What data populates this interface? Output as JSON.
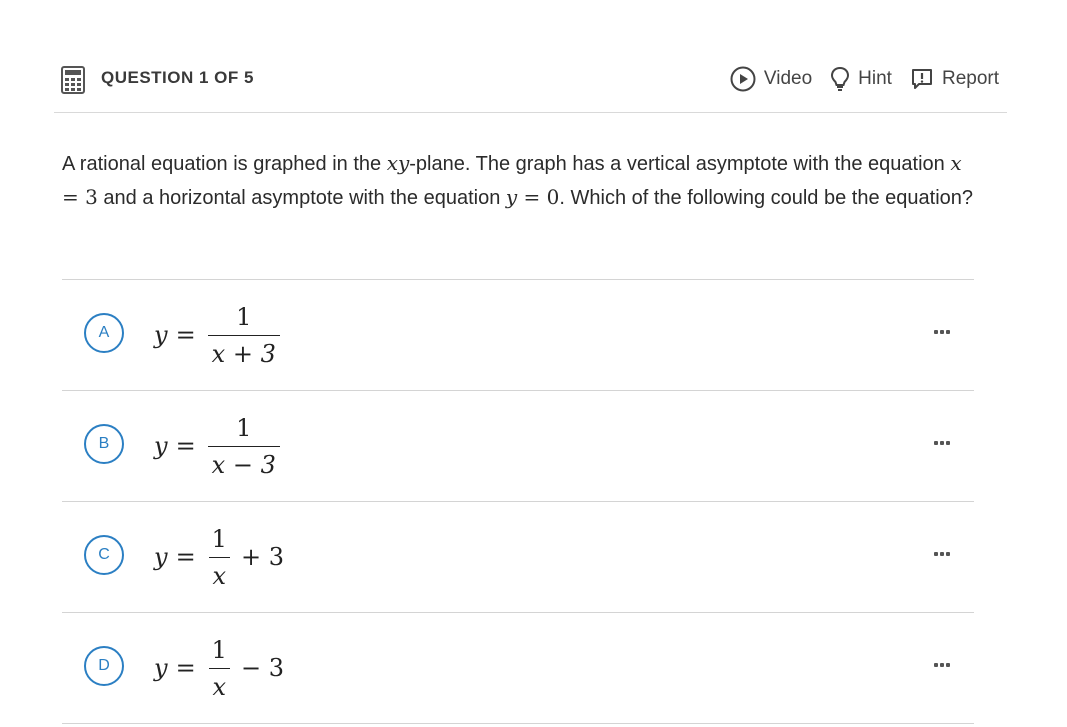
{
  "header": {
    "question_label": "QUESTION 1 OF 5",
    "actions": {
      "video": "Video",
      "hint": "Hint",
      "report": "Report"
    }
  },
  "question": {
    "text_1": "A rational equation is graphed in the ",
    "math_xy": "xy",
    "text_2": "-plane. The graph has a vertical asymptote with the equation ",
    "math_x": "x",
    "math_eq1": " = 3",
    "text_3": " and a horizontal asymptote with the equation ",
    "math_y": "y",
    "math_eq2": " = 0",
    "text_4": ". Which of the following could be the equation?"
  },
  "choices": [
    {
      "letter": "A",
      "lhs": "y",
      "eq": "=",
      "num": "1",
      "den": "x + 3",
      "tail": ""
    },
    {
      "letter": "B",
      "lhs": "y",
      "eq": "=",
      "num": "1",
      "den": "x − 3",
      "tail": ""
    },
    {
      "letter": "C",
      "lhs": "y",
      "eq": "=",
      "num": "1",
      "den": "x",
      "tail": "+ 3"
    },
    {
      "letter": "D",
      "lhs": "y",
      "eq": "=",
      "num": "1",
      "den": "x",
      "tail": "− 3"
    }
  ],
  "colors": {
    "accent": "#2b7fc3",
    "divider": "#d4d4d4"
  },
  "icons": {
    "calculator": "calculator-icon",
    "video": "play-circle-icon",
    "hint": "lightbulb-icon",
    "report": "alert-bubble-icon",
    "more": "more-options-icon"
  }
}
